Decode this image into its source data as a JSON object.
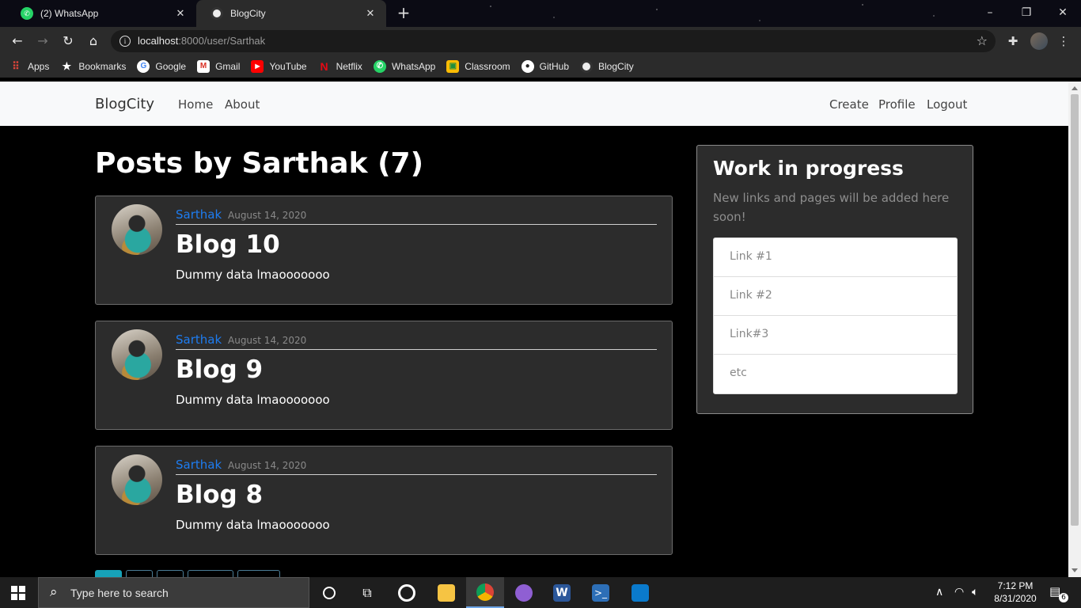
{
  "browser": {
    "tabs": [
      {
        "title": "(2) WhatsApp",
        "icon": "whatsapp-icon",
        "active": false
      },
      {
        "title": "BlogCity",
        "icon": "globe-icon",
        "active": true
      }
    ],
    "url_host": "localhost",
    "url_rest": ":8000/user/Sarthak",
    "bookmarks": [
      {
        "label": "Apps",
        "icon": "apps-grid-icon",
        "color": "#e0463b"
      },
      {
        "label": "Bookmarks",
        "icon": "star-icon",
        "color": "#2b2b2b"
      },
      {
        "label": "Google",
        "icon": "google-icon",
        "color": "#ffffff"
      },
      {
        "label": "Gmail",
        "icon": "gmail-icon",
        "color": "#d93025"
      },
      {
        "label": "YouTube",
        "icon": "youtube-icon",
        "color": "#ff0000"
      },
      {
        "label": "Netflix",
        "icon": "netflix-icon",
        "color": "#e50914"
      },
      {
        "label": "WhatsApp",
        "icon": "whatsapp-icon",
        "color": "#25d366"
      },
      {
        "label": "Classroom",
        "icon": "classroom-icon",
        "color": "#fbbc04"
      },
      {
        "label": "GitHub",
        "icon": "github-icon",
        "color": "#ffffff"
      },
      {
        "label": "BlogCity",
        "icon": "globe-icon",
        "color": "#ffffff"
      }
    ]
  },
  "site": {
    "brand": "BlogCity",
    "nav_left": [
      "Home",
      "About"
    ],
    "nav_right": [
      "Create",
      "Profile",
      "Logout"
    ]
  },
  "main": {
    "heading": "Posts by Sarthak (7)",
    "posts": [
      {
        "author": "Sarthak",
        "date": "August 14, 2020",
        "title": "Blog 10",
        "content": "Dummy data lmaooooooo"
      },
      {
        "author": "Sarthak",
        "date": "August 14, 2020",
        "title": "Blog 9",
        "content": "Dummy data lmaooooooo"
      },
      {
        "author": "Sarthak",
        "date": "August 14, 2020",
        "title": "Blog 8",
        "content": "Dummy data lmaooooooo"
      }
    ]
  },
  "sidebar": {
    "heading": "Work in progress",
    "description": "New links and pages will be added here soon!",
    "links": [
      "Link #1",
      "Link #2",
      "Link#3",
      "etc"
    ]
  },
  "taskbar": {
    "search_placeholder": "Type here to search",
    "time": "7:12 PM",
    "date": "8/31/2020",
    "notification_count": "6"
  },
  "colors": {
    "author_link": "#1e7cf0",
    "card_bg": "#2c2c2c",
    "navbar_bg": "#f8f9fa"
  }
}
